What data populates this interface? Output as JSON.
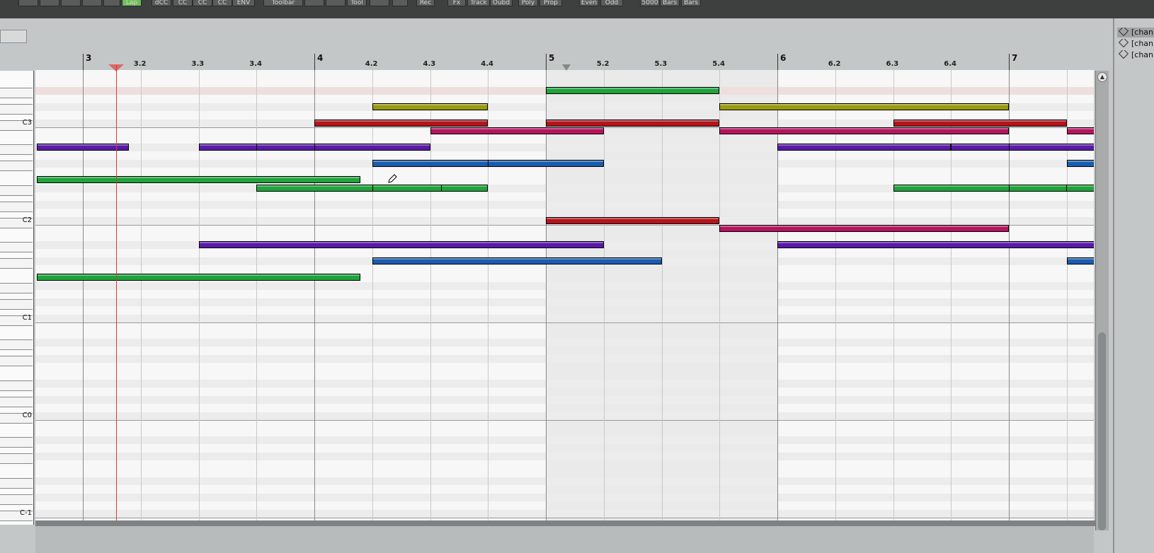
{
  "toolbar": {
    "buttons": [
      {
        "label": "",
        "icon": "swirl-icon"
      },
      {
        "label": "",
        "icon": "window-icon"
      },
      {
        "label": "",
        "icon": "grid-icon"
      },
      {
        "label": "",
        "icon": "loop-icon"
      },
      {
        "label": "",
        "icon": "globe-icon"
      },
      {
        "label": "",
        "icon": "bars-icon"
      },
      {
        "label": "Lap"
      },
      {
        "label": "dCC"
      },
      {
        "label": "CC"
      },
      {
        "label": "CC"
      },
      {
        "label": "CC"
      },
      {
        "label": "ENV"
      },
      {
        "label": "Toolbar"
      },
      {
        "label": "",
        "icon": "rewind-icon"
      },
      {
        "label": "",
        "icon": "forward-icon"
      },
      {
        "label": "Tool"
      },
      {
        "label": "",
        "icon": "expand-icon"
      },
      {
        "label": "",
        "icon": "arrow-icon"
      },
      {
        "label": "Rec"
      },
      {
        "label": "Fx"
      },
      {
        "label": "Track"
      },
      {
        "label": "Oubd"
      },
      {
        "label": "Poly"
      },
      {
        "label": "Prop"
      },
      {
        "label": "Even"
      },
      {
        "label": "Odd"
      },
      {
        "label": "5000"
      },
      {
        "label": "Bars"
      },
      {
        "label": "Bars"
      }
    ]
  },
  "ruler": {
    "labels": [
      "3",
      "3.2",
      "3.3",
      "3.4",
      "4",
      "4.2",
      "4.3",
      "4.4",
      "5",
      "5.2",
      "5.3",
      "5.4",
      "6",
      "6.2",
      "6.3",
      "6.4",
      "7"
    ]
  },
  "piano": {
    "octave_labels": [
      "C3",
      "C2",
      "C1",
      "C0",
      "C-1"
    ]
  },
  "channels": [
    "[chan 1",
    "[chan 2",
    "[chan 3"
  ],
  "colors": {
    "green": "#1ea43a",
    "olive": "#9a9a10",
    "red": "#b4141c",
    "magenta": "#b4155e",
    "purple": "#5a1aa8",
    "blue": "#1a5cb0",
    "playhead": "#d43b3b"
  },
  "notes": [
    {
      "color": "green",
      "start": 5.0,
      "len": 0.75,
      "row": 1
    },
    {
      "color": "olive",
      "start": 4.25,
      "len": 0.5,
      "row": 3
    },
    {
      "color": "olive",
      "start": 5.75,
      "len": 1.25,
      "row": 3
    },
    {
      "color": "red",
      "start": 4.0,
      "len": 0.75,
      "row": 5
    },
    {
      "color": "red",
      "start": 5.0,
      "len": 0.75,
      "row": 5
    },
    {
      "color": "red",
      "start": 6.5,
      "len": 0.75,
      "row": 5
    },
    {
      "color": "magenta",
      "start": 4.5,
      "len": 0.75,
      "row": 6
    },
    {
      "color": "magenta",
      "start": 5.75,
      "len": 1.25,
      "row": 6
    },
    {
      "color": "magenta",
      "start": 7.25,
      "len": 0.65,
      "row": 6
    },
    {
      "color": "purple",
      "start": 2.8,
      "len": 0.4,
      "row": 8
    },
    {
      "color": "purple",
      "start": 3.5,
      "len": 0.75,
      "row": 8
    },
    {
      "color": "purple",
      "start": 3.75,
      "len": 0.5,
      "row": 8
    },
    {
      "color": "purple",
      "start": 4.0,
      "len": 0.5,
      "row": 8
    },
    {
      "color": "purple",
      "start": 6.0,
      "len": 0.75,
      "row": 8
    },
    {
      "color": "purple",
      "start": 6.75,
      "len": 0.5,
      "row": 8
    },
    {
      "color": "purple",
      "start": 7.0,
      "len": 0.5,
      "row": 8
    },
    {
      "color": "purple",
      "start": 7.75,
      "len": 0.15,
      "row": 8
    },
    {
      "color": "blue",
      "start": 4.25,
      "len": 0.75,
      "row": 10
    },
    {
      "color": "blue",
      "start": 4.75,
      "len": 0.5,
      "row": 10
    },
    {
      "color": "blue",
      "start": 7.25,
      "len": 0.65,
      "row": 10
    },
    {
      "color": "green",
      "start": 2.8,
      "len": 1.4,
      "row": 12
    },
    {
      "color": "green",
      "start": 3.75,
      "len": 1.0,
      "row": 13
    },
    {
      "color": "green",
      "start": 4.25,
      "len": 0.3,
      "row": 13
    },
    {
      "color": "green",
      "start": 6.5,
      "len": 1.0,
      "row": 13
    },
    {
      "color": "green",
      "start": 7.0,
      "len": 0.25,
      "row": 13
    },
    {
      "color": "red",
      "start": 5.0,
      "len": 0.75,
      "row": 17
    },
    {
      "color": "magenta",
      "start": 5.75,
      "len": 1.25,
      "row": 18
    },
    {
      "color": "purple",
      "start": 3.5,
      "len": 1.75,
      "row": 20
    },
    {
      "color": "purple",
      "start": 6.0,
      "len": 1.75,
      "row": 20
    },
    {
      "color": "blue",
      "start": 4.25,
      "len": 1.25,
      "row": 22
    },
    {
      "color": "blue",
      "start": 7.25,
      "len": 0.65,
      "row": 22
    },
    {
      "color": "green",
      "start": 2.8,
      "len": 1.4,
      "row": 24
    }
  ]
}
